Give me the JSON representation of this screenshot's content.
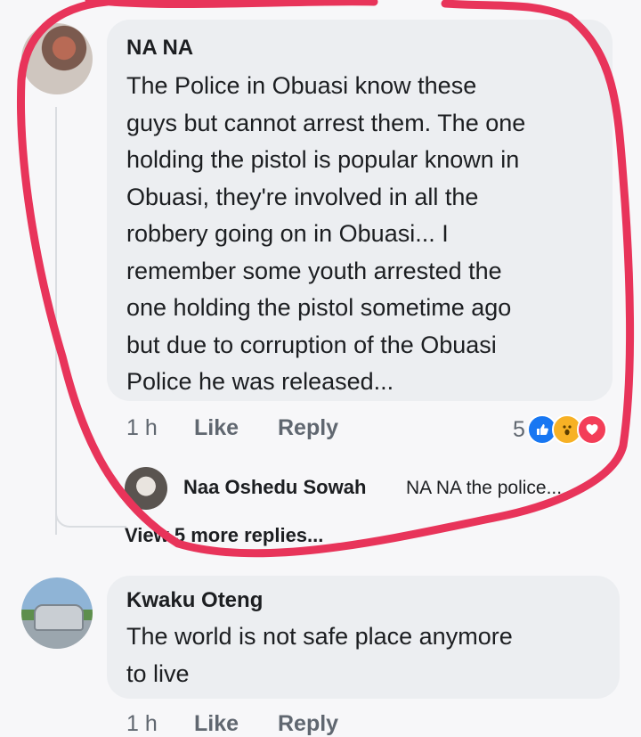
{
  "comments": [
    {
      "author": "NA NA",
      "text": "The Police in Obuasi know these\nguys but cannot arrest them. The one\nholding the pistol is popular known in\nObuasi, they're involved in all the\nrobbery going on in Obuasi... I\nremember some youth arrested the\none holding the pistol sometime ago\nbut due to corruption of the Obuasi\nPolice he was released...",
      "time": "1 h",
      "like_label": "Like",
      "reply_label": "Reply",
      "reaction_count": "5",
      "reactions": [
        "like-icon",
        "wow-icon",
        "love-icon"
      ],
      "reply_preview": {
        "author": "Naa Oshedu Sowah",
        "snippet": "NA NA the police..."
      },
      "view_more": "View 5 more replies..."
    },
    {
      "author": "Kwaku Oteng",
      "text": "The world is not safe place anymore\nto live",
      "time": "1 h",
      "like_label": "Like",
      "reply_label": "Reply"
    }
  ],
  "colors": {
    "bubble": "#eceef1",
    "annotation_circle": "#e8345a",
    "meta_text": "#606770",
    "like_blue": "#1877f2"
  }
}
